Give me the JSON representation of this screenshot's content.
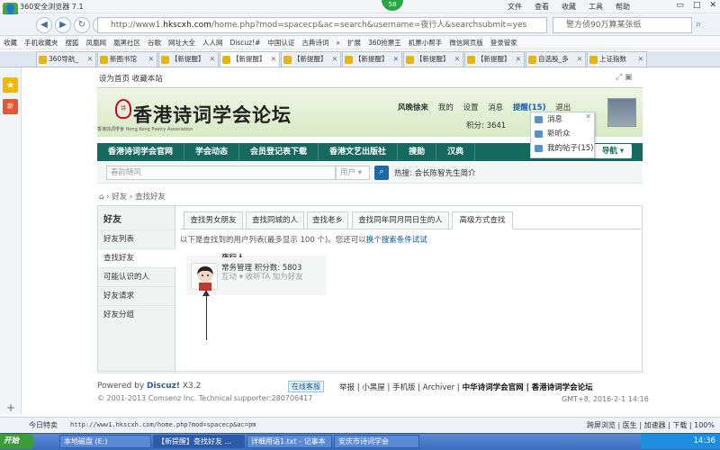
{
  "browser": {
    "title": "360安全浏览器 7.1",
    "menus": [
      "文件",
      "查看",
      "收藏",
      "工具",
      "帮助"
    ],
    "badge": "58",
    "url_prefix": "http://www1.",
    "url_host": "hkscxh.com",
    "url_rest": "/home.php?mod=spacecp&ac=search&username=夜行人&searchsubmit=yes",
    "search_placeholder": "警方侦90万算某张纸",
    "bookmarks": [
      "收藏",
      "手机收藏夹",
      "搜狐",
      "凤凰网",
      "凰黑社区",
      "谷歌",
      "网址大全",
      "人人网",
      "Discuz!#",
      "中国认证",
      "古典诗词",
      "»",
      "扩展",
      "360抢票王",
      "机票小帮手",
      "微信网页版",
      "登录管家"
    ],
    "tabs": [
      {
        "label": "360导航_",
        "active": false
      },
      {
        "label": "新图书馆",
        "active": false
      },
      {
        "label": "【新提醒】",
        "active": false
      },
      {
        "label": "【新提醒】",
        "active": true
      },
      {
        "label": "【新提醒】",
        "active": false
      },
      {
        "label": "【新提醒】",
        "active": false
      },
      {
        "label": "【新提醒】",
        "active": false
      },
      {
        "label": "【新提醒】",
        "active": false
      },
      {
        "label": "自选股_多",
        "active": false
      },
      {
        "label": "上证指数",
        "active": false
      }
    ],
    "side_new": "新"
  },
  "site": {
    "top_links": "设为首页  收藏本站",
    "logo_text": "香港诗词学会论坛",
    "logo_seal": "诗",
    "logo_sub": "香港詩詞學會 Hong Kong Poetry Association",
    "user": {
      "name": "风晚徐来",
      "my": "我的",
      "settings": "设置",
      "messages": "消息",
      "reminder": "提醒(15)",
      "logout": "退出",
      "score": "积分: 3641"
    },
    "dropdown": [
      "消息",
      "新听众",
      "我的帖子(15)"
    ],
    "nav": [
      "香港诗词学会官网",
      "学会动态",
      "会员登记表下载",
      "香港文艺出版社",
      "搜勋",
      "汉典"
    ],
    "nav_more": "导航",
    "search_placeholder": "春韵随风",
    "search_scope": "用户",
    "hot": "热搜: 会长陈智先生简介",
    "breadcrumb": [
      "好友",
      "查找好友"
    ]
  },
  "friends": {
    "sidebar_title": "好友",
    "sidebar_items": [
      "好友列表",
      "查找好友",
      "可能认识的人",
      "好友请求",
      "好友分组"
    ],
    "tabs": [
      "查找男女朋友",
      "查找同城的人",
      "查找老乡",
      "查找同年同月同日生的人",
      "高级方式查找"
    ],
    "note_prefix": "以下是查找到的用户列表(最多显示 100 个)。您还可以",
    "note_link": "换个搜索条件试试",
    "result": {
      "name": "夜行人",
      "role": "常务管理  积分数: 5803",
      "actions": "互动 ▾  收听TA  加为好友"
    }
  },
  "footer": {
    "powered": "Powered by ",
    "brand": "Discuz!",
    "version": " X3.2",
    "copyright": "© 2001-2013 Comsenz Inc.  Technical supporter:280706417",
    "online": "在线客服",
    "links": "举报 | 小黑屋 | 手机版 | Archiver |",
    "links_bold": " 中华诗词学会官网 | 香港诗词学会论坛",
    "time": "GMT+8, 2016-2-1 14:16"
  },
  "status": {
    "left": "今日特卖",
    "url": "http://www1.hkscxh.com/home.php?mod=spacecp&ac=pm",
    "right": "跨屏浏览  |  医生  |  加速器  |  下载  |  100%"
  },
  "taskbar": {
    "start": "开始",
    "tasks": [
      "本地磁盘 (E:)",
      "【新提醒】查找好友 ...",
      "详细用语1.txt - 记事本",
      "安庆市诗词学会"
    ],
    "clock": "14:36"
  }
}
